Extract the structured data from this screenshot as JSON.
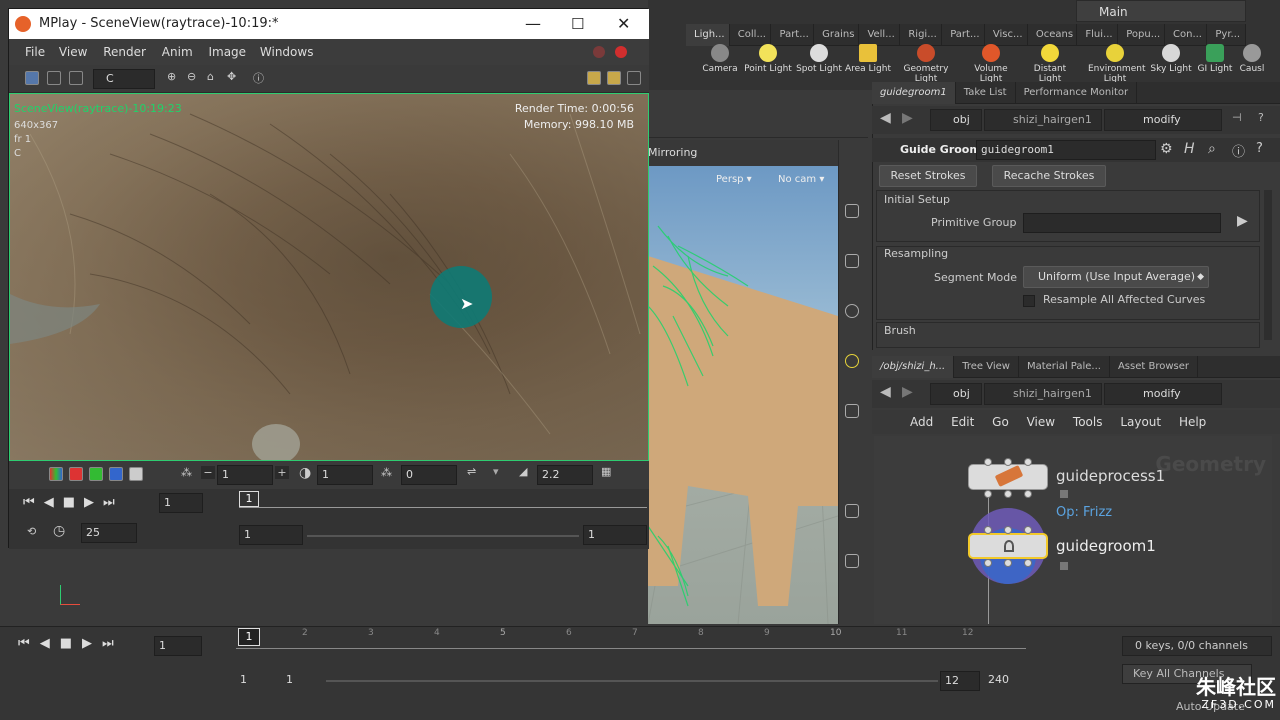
{
  "mplay": {
    "title": "MPlay - SceneView(raytrace)-10:19:*",
    "menu": [
      "File",
      "View",
      "Render",
      "Anim",
      "Image",
      "Windows"
    ],
    "channel": "C",
    "overlay_name": "SceneView(raytrace)-10:19:23",
    "overlay_res": "640x367",
    "overlay_frame": "fr 1",
    "overlay_channel": "C",
    "render_time": "Render Time: 0:00:56",
    "memory": "Memory:  998.10 MB",
    "bottom_field1": "1",
    "bottom_field2": "1",
    "bottom_field3": "0",
    "gamma": "2.2",
    "frame_field": "1",
    "timeline_marker": "1",
    "fps": "25",
    "range_start": "1",
    "range_end": "1"
  },
  "desktop": {
    "main_label": "Main",
    "shelf_tabs": [
      "Ligh...",
      "Coll...",
      "Part...",
      "Grains",
      "Vell...",
      "Rigi...",
      "Part...",
      "Visc...",
      "Oceans",
      "Flui...",
      "Popu...",
      "Con...",
      "Pyr..."
    ],
    "shelf_tools": [
      "Camera",
      "Point Light",
      "Spot Light",
      "Area Light",
      "Geometry Light",
      "Volume Light",
      "Distant Light",
      "Environment Light",
      "Sky Light",
      "GI Light",
      "Causl"
    ],
    "viewport": {
      "mirroring": "Mirroring",
      "persp": "Persp",
      "nocam": "No cam"
    }
  },
  "param_panel": {
    "tabs": [
      "guidegroom1",
      "Take List",
      "Performance Monitor"
    ],
    "path": [
      "obj",
      "shizi_hairgen1",
      "modify"
    ],
    "node_type": "Guide Groom",
    "node_name": "guidegroom1",
    "reset_strokes": "Reset Strokes",
    "recache_strokes": "Recache Strokes",
    "initial_setup": "Initial Setup",
    "primitive_group_label": "Primitive Group",
    "resampling": "Resampling",
    "segment_mode_label": "Segment Mode",
    "segment_mode_value": "Uniform (Use Input Average)",
    "resample_all": "Resample All Affected Curves",
    "brush": "Brush"
  },
  "network_panel": {
    "tabs": [
      "/obj/shizi_h...",
      "Tree View",
      "Material Pale...",
      "Asset Browser"
    ],
    "path": [
      "obj",
      "shizi_hairgen1",
      "modify"
    ],
    "menu": [
      "Add",
      "Edit",
      "Go",
      "View",
      "Tools",
      "Layout",
      "Help"
    ],
    "context_label": "Geometry",
    "node1": "guideprocess1",
    "node1_op": "Op: Frizz",
    "node2": "guidegroom1"
  },
  "playbar": {
    "frame": "1",
    "ticks": [
      "1",
      "2",
      "3",
      "4",
      "5",
      "6",
      "7",
      "8",
      "9",
      "10",
      "11",
      "12"
    ],
    "start1": "1",
    "start2": "1",
    "end1": "12",
    "end2": "240",
    "keys": "0 keys, 0/0 channels",
    "key_all": "Key All Channels",
    "auto_update": "Auto Update"
  },
  "watermark": {
    "text": "朱峰社区",
    "url": "ZF3D.COM"
  },
  "colors": {
    "accent_green": "#1fd36a",
    "node_selected": "#f2c92a",
    "brush_teal": "#0e7a74"
  }
}
